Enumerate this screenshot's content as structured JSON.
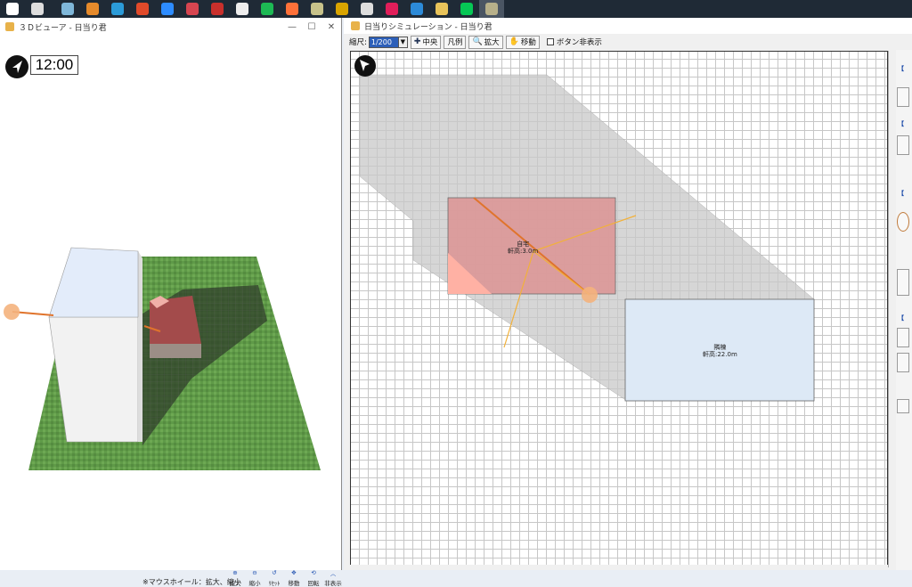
{
  "taskbar": {
    "items": [
      {
        "icon": "windows-start-icon",
        "color": "#ffffff"
      },
      {
        "icon": "task-view-icon",
        "color": "#dddddd"
      },
      {
        "icon": "notebook-app-icon",
        "color": "#7fb7d9"
      },
      {
        "icon": "media-app-icon",
        "color": "#e58a2b"
      },
      {
        "icon": "edge-browser-icon",
        "color": "#2b9bd8"
      },
      {
        "icon": "office-icon",
        "color": "#e04a2a"
      },
      {
        "icon": "zoom-icon",
        "color": "#2d8cff"
      },
      {
        "icon": "app-red-icon",
        "color": "#d64550"
      },
      {
        "icon": "app-red2-icon",
        "color": "#c9302c"
      },
      {
        "icon": "app-bw-icon",
        "color": "#eeeeee"
      },
      {
        "icon": "spotify-icon",
        "color": "#1db954"
      },
      {
        "icon": "firefox-icon",
        "color": "#ff7139"
      },
      {
        "icon": "app-circle-icon",
        "color": "#c7c28a"
      },
      {
        "icon": "sun-app-icon",
        "color": "#d9a400"
      },
      {
        "icon": "app-alien-icon",
        "color": "#dddddd"
      },
      {
        "icon": "slack-icon",
        "color": "#e01e5a"
      },
      {
        "icon": "calendar-icon",
        "color": "#2c8ad8"
      },
      {
        "icon": "folder-icon",
        "color": "#e8c35a"
      },
      {
        "icon": "line-icon",
        "color": "#06c755"
      },
      {
        "icon": "sun-sim-icon",
        "color": "#b7b08a"
      }
    ]
  },
  "viewer3d": {
    "title": "３Ｄビューア - 日当り君",
    "clock": "12:00",
    "hint": "※マウスホイール：拡大、縮小",
    "tools": [
      {
        "label": "拡大",
        "icon": "zoom-in-icon"
      },
      {
        "label": "縮小",
        "icon": "zoom-out-icon"
      },
      {
        "label": "ﾘｾｯﾄ",
        "icon": "reset-icon"
      },
      {
        "label": "移動",
        "icon": "move-icon"
      },
      {
        "label": "回転",
        "icon": "rotate-icon"
      },
      {
        "label": "非表示",
        "icon": "hide-icon"
      }
    ]
  },
  "simulation": {
    "title": "日当りシミュレーション - 日当り君",
    "toolbar": {
      "scale_label": "縮尺:",
      "scale_value": "1/200",
      "center_label": "中央",
      "legend_label": "凡例",
      "zoom_label": "拡大",
      "move_label": "移動",
      "hide_buttons_label": "ボタン非表示"
    },
    "buildings": [
      {
        "name": "自宅",
        "height": "軒高:3.0m"
      },
      {
        "name": "隣棟",
        "height": "軒高:22.0m"
      }
    ]
  },
  "colors": {
    "shadow": "#d3d3d3",
    "home": "#dd9a9a",
    "neighbor": "#dce9f6",
    "sun": "#f4b27d",
    "sunray": "#f2b13a"
  }
}
